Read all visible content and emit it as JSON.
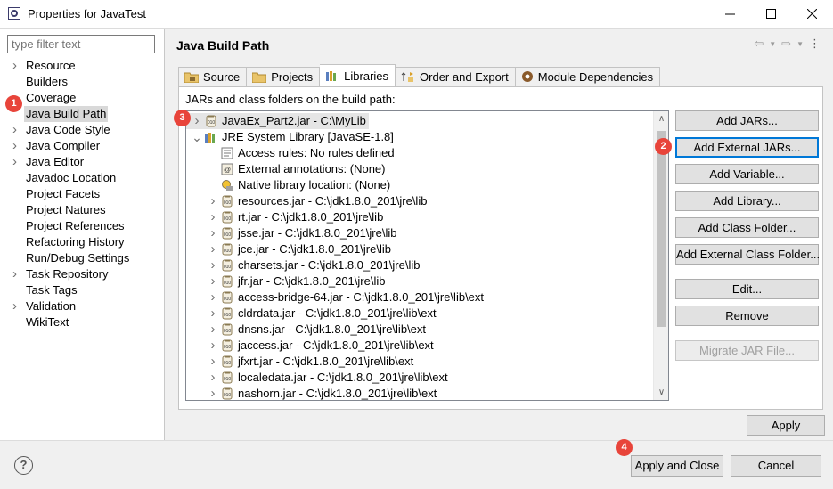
{
  "window": {
    "title": "Properties for JavaTest"
  },
  "filter": {
    "placeholder": "type filter text"
  },
  "nav": [
    {
      "label": "Resource",
      "expandable": true
    },
    {
      "label": "Builders",
      "expandable": false
    },
    {
      "label": "Coverage",
      "expandable": false
    },
    {
      "label": "Java Build Path",
      "expandable": false,
      "selected": true
    },
    {
      "label": "Java Code Style",
      "expandable": true
    },
    {
      "label": "Java Compiler",
      "expandable": true
    },
    {
      "label": "Java Editor",
      "expandable": true
    },
    {
      "label": "Javadoc Location",
      "expandable": false
    },
    {
      "label": "Project Facets",
      "expandable": false
    },
    {
      "label": "Project Natures",
      "expandable": false
    },
    {
      "label": "Project References",
      "expandable": false
    },
    {
      "label": "Refactoring History",
      "expandable": false
    },
    {
      "label": "Run/Debug Settings",
      "expandable": false
    },
    {
      "label": "Task Repository",
      "expandable": true
    },
    {
      "label": "Task Tags",
      "expandable": false
    },
    {
      "label": "Validation",
      "expandable": true
    },
    {
      "label": "WikiText",
      "expandable": false
    }
  ],
  "page": {
    "title": "Java Build Path"
  },
  "tabs": [
    {
      "label": "Source",
      "icon": "source-folder-icon"
    },
    {
      "label": "Projects",
      "icon": "projects-folder-icon"
    },
    {
      "label": "Libraries",
      "icon": "libraries-icon",
      "active": true
    },
    {
      "label": "Order and Export",
      "icon": "order-export-icon"
    },
    {
      "label": "Module Dependencies",
      "icon": "module-icon"
    }
  ],
  "panel": {
    "label": "JARs and class folders on the build path:"
  },
  "tree": [
    {
      "label": "JavaEx_Part2.jar - C:\\MyLib",
      "indent": 0,
      "twisty": "collapsed",
      "icon": "jar-icon",
      "selected": true
    },
    {
      "label": "JRE System Library [JavaSE-1.8]",
      "indent": 0,
      "twisty": "expanded",
      "icon": "library-icon"
    },
    {
      "label": "Access rules: No rules defined",
      "indent": 1,
      "twisty": "none",
      "icon": "access-rules-icon"
    },
    {
      "label": "External annotations: (None)",
      "indent": 1,
      "twisty": "none",
      "icon": "annotations-icon"
    },
    {
      "label": "Native library location: (None)",
      "indent": 1,
      "twisty": "none",
      "icon": "native-library-icon"
    },
    {
      "label": "resources.jar - C:\\jdk1.8.0_201\\jre\\lib",
      "indent": 1,
      "twisty": "collapsed",
      "icon": "jar-icon"
    },
    {
      "label": "rt.jar - C:\\jdk1.8.0_201\\jre\\lib",
      "indent": 1,
      "twisty": "collapsed",
      "icon": "jar-icon"
    },
    {
      "label": "jsse.jar - C:\\jdk1.8.0_201\\jre\\lib",
      "indent": 1,
      "twisty": "collapsed",
      "icon": "jar-icon"
    },
    {
      "label": "jce.jar - C:\\jdk1.8.0_201\\jre\\lib",
      "indent": 1,
      "twisty": "collapsed",
      "icon": "jar-icon"
    },
    {
      "label": "charsets.jar - C:\\jdk1.8.0_201\\jre\\lib",
      "indent": 1,
      "twisty": "collapsed",
      "icon": "jar-icon"
    },
    {
      "label": "jfr.jar - C:\\jdk1.8.0_201\\jre\\lib",
      "indent": 1,
      "twisty": "collapsed",
      "icon": "jar-icon"
    },
    {
      "label": "access-bridge-64.jar - C:\\jdk1.8.0_201\\jre\\lib\\ext",
      "indent": 1,
      "twisty": "collapsed",
      "icon": "jar-icon"
    },
    {
      "label": "cldrdata.jar - C:\\jdk1.8.0_201\\jre\\lib\\ext",
      "indent": 1,
      "twisty": "collapsed",
      "icon": "jar-icon"
    },
    {
      "label": "dnsns.jar - C:\\jdk1.8.0_201\\jre\\lib\\ext",
      "indent": 1,
      "twisty": "collapsed",
      "icon": "jar-icon"
    },
    {
      "label": "jaccess.jar - C:\\jdk1.8.0_201\\jre\\lib\\ext",
      "indent": 1,
      "twisty": "collapsed",
      "icon": "jar-icon"
    },
    {
      "label": "jfxrt.jar - C:\\jdk1.8.0_201\\jre\\lib\\ext",
      "indent": 1,
      "twisty": "collapsed",
      "icon": "jar-icon"
    },
    {
      "label": "localedata.jar - C:\\jdk1.8.0_201\\jre\\lib\\ext",
      "indent": 1,
      "twisty": "collapsed",
      "icon": "jar-icon"
    },
    {
      "label": "nashorn.jar - C:\\jdk1.8.0_201\\jre\\lib\\ext",
      "indent": 1,
      "twisty": "collapsed",
      "icon": "jar-icon"
    }
  ],
  "buttons": [
    {
      "label": "Add JARs...",
      "name": "add-jars-button"
    },
    {
      "label": "Add External JARs...",
      "name": "add-external-jars-button",
      "focus": true
    },
    {
      "label": "Add Variable...",
      "name": "add-variable-button"
    },
    {
      "label": "Add Library...",
      "name": "add-library-button"
    },
    {
      "label": "Add Class Folder...",
      "name": "add-class-folder-button"
    },
    {
      "label": "Add External Class Folder...",
      "name": "add-external-class-folder-button"
    },
    {
      "label": "Edit...",
      "name": "edit-button"
    },
    {
      "label": "Remove",
      "name": "remove-button"
    },
    {
      "label": "Migrate JAR File...",
      "name": "migrate-jar-file-button",
      "disabled": true
    }
  ],
  "apply": "Apply",
  "footer": {
    "apply_close": "Apply and Close",
    "cancel": "Cancel"
  },
  "badges": [
    "1",
    "2",
    "3",
    "4"
  ],
  "colors": {
    "badge": "#e8443a",
    "focus": "#0078d7",
    "selection": "#d9d9d9"
  }
}
